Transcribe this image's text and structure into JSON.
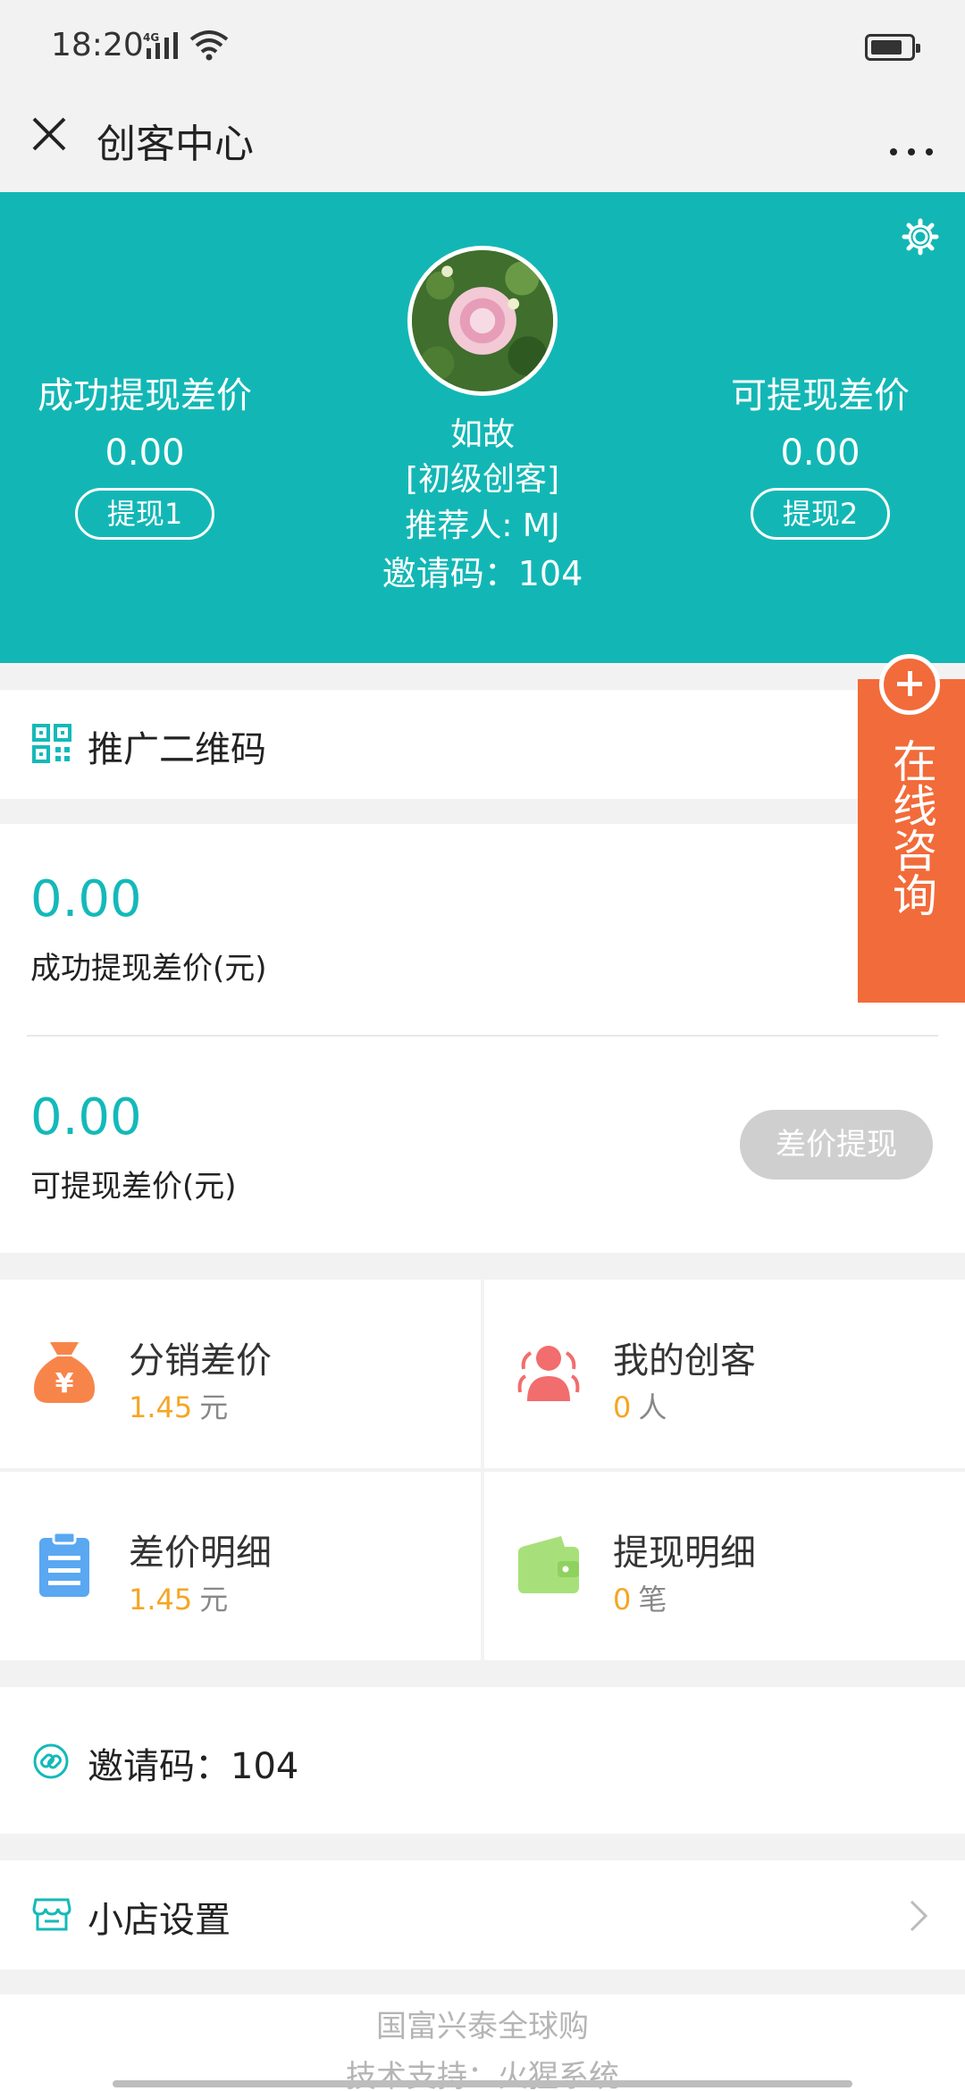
{
  "status_bar": {
    "time": "18:20",
    "network": "4G"
  },
  "nav": {
    "title": "创客中心"
  },
  "header": {
    "left": {
      "label": "成功提现差价",
      "value": "0.00",
      "button": "提现1"
    },
    "right": {
      "label": "可提现差价",
      "value": "0.00",
      "button": "提现2"
    },
    "name": "如故",
    "level": "[初级创客]",
    "referrer": "推荐人: MJ",
    "invite_code": "邀请码：104"
  },
  "qr_row": {
    "label": "推广二维码"
  },
  "stats": {
    "success_value": "0.00",
    "success_label": "成功提现差价(元)",
    "available_value": "0.00",
    "available_label": "可提现差价(元)",
    "withdraw_button": "差价提现"
  },
  "grid": [
    {
      "title": "分销差价",
      "num": "1.45",
      "unit": "元",
      "icon": "money-bag-icon"
    },
    {
      "title": "我的创客",
      "num": "0",
      "unit": "人",
      "icon": "users-icon"
    },
    {
      "title": "差价明细",
      "num": "1.45",
      "unit": "元",
      "icon": "clipboard-icon"
    },
    {
      "title": "提现明细",
      "num": "0",
      "unit": "笔",
      "icon": "wallet-icon"
    }
  ],
  "invite_row": {
    "label": "邀请码：104"
  },
  "shop_row": {
    "label": "小店设置"
  },
  "footer": {
    "line1": "国富兴泰全球购",
    "line2": "技术支持：火猩系统"
  },
  "consult": {
    "label": "在线咨询"
  },
  "colors": {
    "teal": "#12b7b5",
    "orange": "#f26b3a",
    "amount": "#f5a623"
  }
}
